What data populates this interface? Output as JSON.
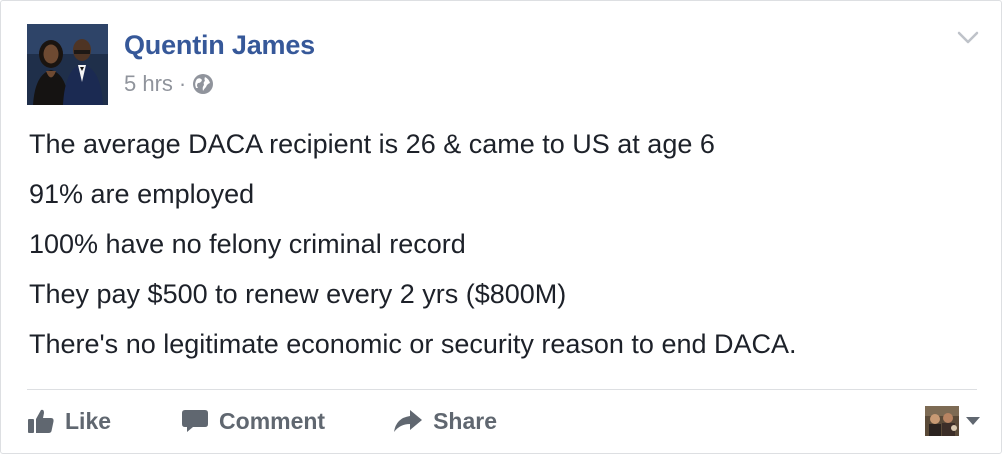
{
  "post": {
    "author": "Quentin James",
    "timestamp": "5 hrs",
    "separator": "·",
    "privacy_icon": "globe-icon",
    "menu_icon": "chevron-down-icon",
    "lines": [
      "The average DACA recipient is 26 & came to US at age 6",
      "91% are employed",
      "100% have no felony criminal record",
      "They pay $500 to renew every 2 yrs ($800M)",
      "There's no legitimate economic or security reason to end DACA."
    ]
  },
  "actions": {
    "like_label": "Like",
    "like_icon": "thumbs-up-icon",
    "comment_label": "Comment",
    "comment_icon": "speech-bubble-icon",
    "share_label": "Share",
    "share_icon": "share-arrow-icon",
    "audience_icon": "caret-down-icon"
  },
  "colors": {
    "author_link": "#365899",
    "meta_text": "#90949c",
    "body_text": "#1d2129",
    "action_text": "#606770",
    "divider": "#dddfe2"
  }
}
